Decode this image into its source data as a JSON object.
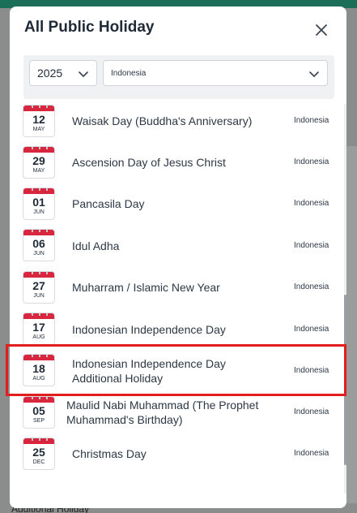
{
  "modal": {
    "title": "All Public Holiday",
    "year_value": "2025",
    "country_value": "Indonesia"
  },
  "holidays": [
    {
      "day": "12",
      "month": "MAY",
      "name": "Waisak Day (Buddha's Anniversary)",
      "country": "Indonesia"
    },
    {
      "day": "29",
      "month": "MAY",
      "name": "Ascension Day of Jesus Christ",
      "country": "Indonesia"
    },
    {
      "day": "01",
      "month": "JUN",
      "name": "Pancasila Day",
      "country": "Indonesia"
    },
    {
      "day": "06",
      "month": "JUN",
      "name": "Idul Adha",
      "country": "Indonesia"
    },
    {
      "day": "27",
      "month": "JUN",
      "name": "Muharram / Islamic New Year",
      "country": "Indonesia"
    },
    {
      "day": "17",
      "month": "AUG",
      "name": "Indonesian Independence Day",
      "country": "Indonesia"
    },
    {
      "day": "18",
      "month": "AUG",
      "name": "Indonesian Independence Day Additional Holiday",
      "country": "Indonesia"
    },
    {
      "day": "05",
      "month": "SEP",
      "name": "Maulid Nabi Muhammad (The Prophet Muhammad's Birthday)",
      "country": "Indonesia"
    },
    {
      "day": "25",
      "month": "DEC",
      "name": "Christmas Day",
      "country": "Indonesia"
    }
  ],
  "background": {
    "bottom_text": "Additional Holiday"
  },
  "colors": {
    "calendar_header": "#d7263d",
    "highlight_border": "#e11d1d",
    "top_bar": "#1b6e58"
  }
}
